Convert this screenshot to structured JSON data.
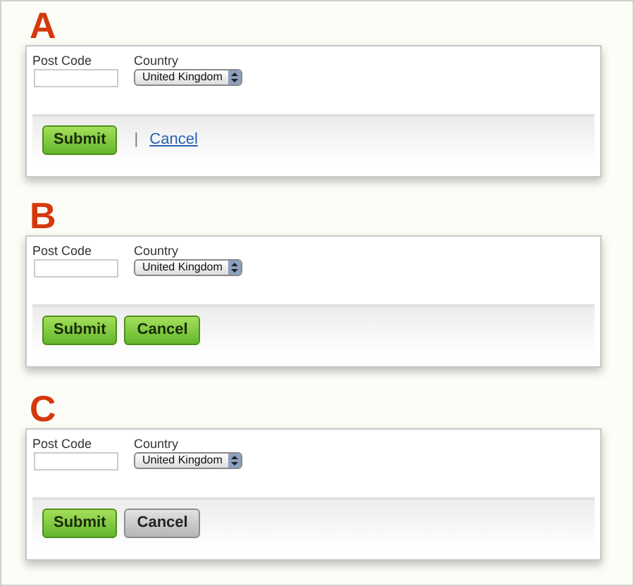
{
  "variants": [
    {
      "letter": "A",
      "fields": {
        "post_code_label": "Post Code",
        "country_label": "Country",
        "country_value": "United Kingdom"
      },
      "submit": "Submit",
      "separator": "|",
      "cancel": {
        "label": "Cancel",
        "kind": "link"
      }
    },
    {
      "letter": "B",
      "fields": {
        "post_code_label": "Post Code",
        "country_label": "Country",
        "country_value": "United Kingdom"
      },
      "submit": "Submit",
      "cancel": {
        "label": "Cancel",
        "kind": "primary"
      }
    },
    {
      "letter": "C",
      "fields": {
        "post_code_label": "Post Code",
        "country_label": "Country",
        "country_value": "United Kingdom"
      },
      "submit": "Submit",
      "cancel": {
        "label": "Cancel",
        "kind": "secondary"
      }
    }
  ]
}
